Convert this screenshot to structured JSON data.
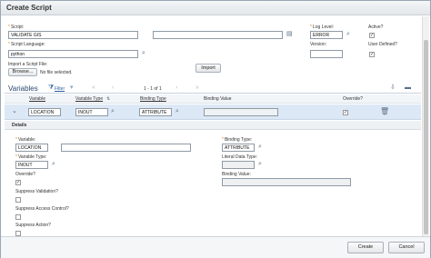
{
  "dialog": {
    "title": "Create Script"
  },
  "script": {
    "script_label": "Script:",
    "script_value": "VALIDATE GIS",
    "description_value": "",
    "log_level_label": "Log Level:",
    "log_level_value": "ERROR",
    "active_label": "Active?",
    "active_checked": "✓",
    "language_label": "Script Language:",
    "language_value": "python",
    "version_label": "Version:",
    "version_value": "",
    "user_defined_label": "User Defined?",
    "user_defined_checked": "✓",
    "import_label": "Import a Script File:",
    "browse_label": "Browse...",
    "no_file_text": "No file selected.",
    "import_button": "Import"
  },
  "variables": {
    "section_title": "Variables",
    "filter_label": "Filter",
    "pager_text": "1 - 1 of 1",
    "columns": [
      "Variable",
      "Variable Type",
      "Binding Type",
      "Binding Value",
      "Override?"
    ],
    "rows": [
      {
        "variable": "LOCATION",
        "variable_type": "INOUT",
        "binding_type": "ATTRIBUTE",
        "binding_value": "",
        "override": "✓"
      }
    ]
  },
  "details": {
    "title": "Details",
    "variable_label": "Variable:",
    "variable_value": "LOCATION",
    "variable_desc_value": "",
    "binding_type_label": "Binding Type:",
    "binding_type_value": "ATTRIBUTE",
    "variable_type_label": "Variable Type:",
    "variable_type_value": "INOUT",
    "literal_type_label": "Literal Data Type:",
    "literal_type_value": "",
    "override_label": "Override?",
    "override_checked": "✓",
    "binding_value_label": "Binding Value:",
    "binding_value_value": "",
    "suppress_validation_label": "Suppress Validation?",
    "suppress_access_label": "Suppress Access Control?",
    "suppress_action_label": "Suppress Action?"
  },
  "footer": {
    "create_button": "Create",
    "cancel_button": "Cancel"
  },
  "icons": {
    "lookup": "magnifier-icon",
    "detail": "detail-menu-icon",
    "calendar": "long-description-icon",
    "filter": "filter-icon",
    "delete": "trash-icon",
    "expand": "expand-row-icon"
  }
}
